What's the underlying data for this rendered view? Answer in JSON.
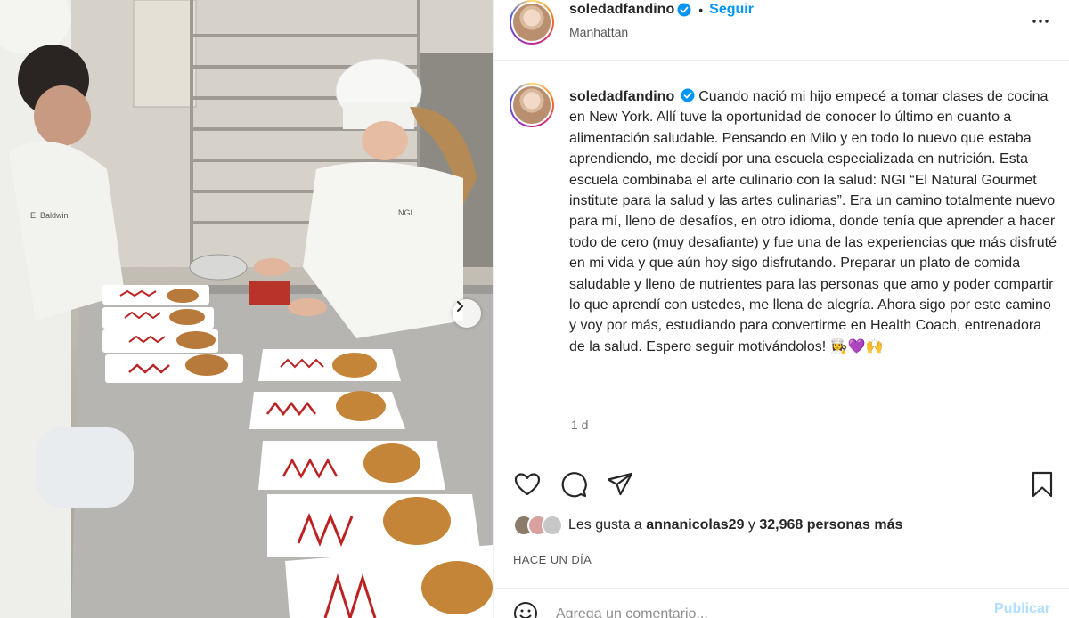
{
  "post": {
    "username": "soledadfandino",
    "follow_label": "Seguir",
    "location": "Manhattan",
    "caption": "Cuando nació mi hijo empecé a tomar clases de cocina en New York. Allí tuve la oportunidad de conocer lo último en cuanto a alimentación saludable. Pensando en Milo y en todo lo nuevo que estaba aprendiendo, me decidí por una escuela especializada en nutrición. Esta escuela combinaba el arte culinario con la salud: NGI “El Natural Gourmet institute para la salud y las artes culinarias”. Era un camino totalmente nuevo para mí, lleno de desafíos, en otro idioma, donde tenía que aprender a hacer todo de cero (muy desafiante) y fue una de las experiencias que más disfruté en mi vida y que aún hoy sigo disfrutando. Preparar un plato de comida saludable y lleno de nutrientes para las personas que amo y poder compartir lo que aprendí con ustedes, me llena de alegría. Ahora sigo por este camino y voy por más, estudiando para convertirme en Health Coach, entrenadora de la salud. Espero seguir motivándolos! 👩‍🍳💜🙌",
    "time": "1 d",
    "likes_prefix": "Les gusta a",
    "likes_user": "annanicolas29",
    "likes_joiner": "y",
    "likes_count": "32,968 personas más",
    "ago": "HACE UN DÍA",
    "comment_placeholder": "Agrega un comentario...",
    "publish_label": "Publicar"
  },
  "photo": {
    "jacket_text_left": "E. Baldwin",
    "jacket_text_right": "NGI"
  },
  "icons": {
    "more": "more-horizontal-icon",
    "like": "heart-icon",
    "comment": "comment-icon",
    "share": "share-icon",
    "save": "bookmark-icon",
    "emoji": "emoji-icon",
    "next": "chevron-right-icon",
    "verified": "verified-badge-icon"
  },
  "colors": {
    "link": "#0095f6",
    "text": "#262626",
    "muted": "#737373",
    "publish_disabled": "#b2dffc"
  }
}
